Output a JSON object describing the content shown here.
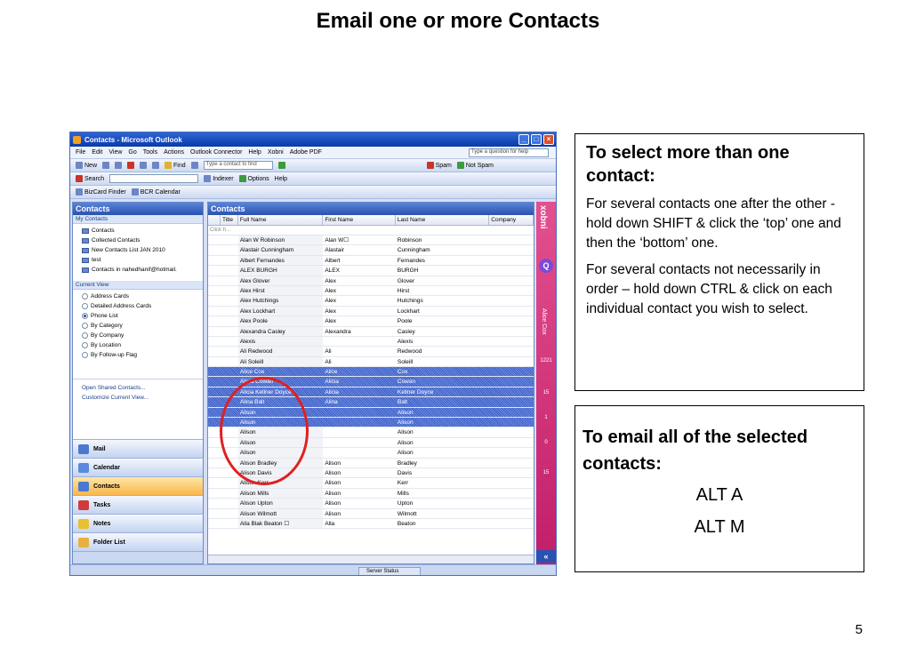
{
  "slide": {
    "title": "Email one or more Contacts",
    "page_number": "5"
  },
  "window": {
    "title": "Contacts - Microsoft Outlook",
    "menu": [
      "File",
      "Edit",
      "View",
      "Go",
      "Tools",
      "Actions",
      "Outlook Connector",
      "Help",
      "Xobni",
      "Adobe PDF"
    ],
    "help_placeholder": "Type a question for help",
    "toolbar1": {
      "new": "New",
      "find": "Find",
      "search_placeholder": "Type a contact to find",
      "spam": "Spam",
      "not_spam": "Not Spam"
    },
    "toolbar2": {
      "search": "Search",
      "indexer": "Indexer",
      "options": "Options",
      "help": "Help"
    },
    "toolbar3": {
      "bizcard": "BizCard Finder",
      "bcr": "BCR Calendar"
    },
    "nav": {
      "header": "Contacts",
      "my_contacts": "My Contacts",
      "folders": [
        "Contacts",
        "Collected Contacts",
        "New Contacts List JAN 2010",
        "test",
        "Contacts in nahedhanif@hotmail."
      ],
      "current_view": "Current View",
      "views": [
        "Address Cards",
        "Detailed Address Cards",
        "Phone List",
        "By Category",
        "By Company",
        "By Location",
        "By Follow-up Flag"
      ],
      "links": [
        "Open Shared Contacts...",
        "Customize Current View..."
      ],
      "buttons": [
        "Mail",
        "Calendar",
        "Contacts",
        "Tasks",
        "Notes",
        "Folder List"
      ]
    },
    "grid": {
      "header": "Contacts",
      "columns": [
        "Title",
        "Full Name",
        "First Name",
        "Last Name",
        "Company"
      ],
      "click_here": "Click h...",
      "rows": [
        [
          "Alan W Robinson",
          "Alan W☐",
          "Robinson"
        ],
        [
          "Alastair Cunningham",
          "Alastair",
          "Cunningham"
        ],
        [
          "Albert Fernandes",
          "Albert",
          "Fernandes"
        ],
        [
          "ALEX BURGH",
          "ALEX",
          "BURGH"
        ],
        [
          "Alex Glover",
          "Alex",
          "Glover"
        ],
        [
          "Alex Hirst",
          "Alex",
          "Hirst"
        ],
        [
          "Alex Hutchings",
          "Alex",
          "Hutchings"
        ],
        [
          "Alex Lockhart",
          "Alex",
          "Lockhart"
        ],
        [
          "Alex Poole",
          "Alex",
          "Poole"
        ],
        [
          "Alexandra Casley",
          "Alexandra",
          "Casley"
        ],
        [
          "Alexis",
          "",
          "Alexis"
        ],
        [
          "Ali Redwood",
          "Ali",
          "Redwood"
        ],
        [
          "Ali Soleill",
          "Ali",
          "Soleill"
        ],
        [
          "Alice Cox",
          "Alice",
          "Cox"
        ],
        [
          "Alicia Cowan",
          "Alicia",
          "Cowan"
        ],
        [
          "Alicia Kellner Doyce",
          "Alicia",
          "Kellner Doyce"
        ],
        [
          "Alina Balt",
          "Alina",
          "Balt"
        ],
        [
          "Alison",
          "",
          "Alison"
        ],
        [
          "Alison",
          "",
          "Alison"
        ],
        [
          "Alison",
          "",
          "Alison"
        ],
        [
          "Alison",
          "",
          "Alison"
        ],
        [
          "Alison",
          "",
          "Alison"
        ],
        [
          "Alison Bradley",
          "Alison",
          "Bradley"
        ],
        [
          "Alison Davis",
          "Alison",
          "Davis"
        ],
        [
          "Alison Kerr",
          "Alison",
          "Kerr"
        ],
        [
          "Alison Mills",
          "Alison",
          "Mills"
        ],
        [
          "Alison Upton",
          "Alison",
          "Upton"
        ],
        [
          "Alison Wilmott",
          "Alison",
          "Wilmott"
        ],
        [
          "Alla Blak Beaton ☐",
          "Alla",
          "Beaton"
        ]
      ],
      "selected_rows": [
        13,
        14,
        15,
        16,
        17,
        18
      ]
    },
    "xobni": {
      "label": "xobni",
      "search": "Q",
      "contact": "Alice Cox",
      "stats": [
        "1221",
        "15",
        "1",
        "0",
        "15"
      ],
      "collapse": "«"
    },
    "status": "Server Status"
  },
  "instructions": {
    "select_title": "To select more than one contact:",
    "select_p1": "For several contacts one after the other - hold down SHIFT & click the ‘top’ one and then the ‘bottom’ one.",
    "select_p2": "For several contacts not necessarily in order – hold down CTRL & click on each individual contact you wish to select.",
    "email_title": "To email all of the selected contacts:",
    "key1": "ALT A",
    "key2": "ALT M"
  }
}
